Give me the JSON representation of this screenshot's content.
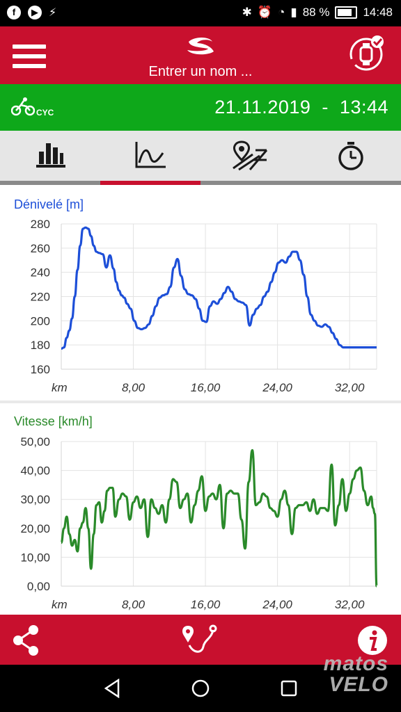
{
  "status": {
    "battery": "88 %",
    "time": "14:48"
  },
  "header": {
    "title": "Entrer un nom ..."
  },
  "activity": {
    "sport": "CYC",
    "date": "21.11.2019",
    "separator": "-",
    "time": "13:44"
  },
  "tabs": [
    {
      "icon": "bar-chart-icon",
      "active": false
    },
    {
      "icon": "line-chart-icon",
      "active": true
    },
    {
      "icon": "map-route-icon",
      "active": false
    },
    {
      "icon": "stopwatch-icon",
      "active": false
    }
  ],
  "watermark": [
    "matos",
    "VELO"
  ],
  "colors": {
    "brand": "#c8102e",
    "activity": "#0ea81a",
    "elevation": "#1d4fd8",
    "speed": "#2a8a2a"
  },
  "chart_data": [
    {
      "type": "line",
      "title": "Dénivelé [m]",
      "xlabel": "km",
      "ylabel": "",
      "xlim": [
        0,
        35
      ],
      "ylim": [
        160,
        280
      ],
      "xticks": [
        8,
        16,
        24,
        32
      ],
      "xtick_labels": [
        "8,00",
        "16,00",
        "24,00",
        "32,00"
      ],
      "yticks": [
        160,
        180,
        200,
        220,
        240,
        260,
        280
      ],
      "ytick_labels": [
        "160",
        "180",
        "200",
        "220",
        "240",
        "260",
        "280"
      ],
      "grid": true,
      "series": [
        {
          "x": [
            0,
            0.3,
            0.6,
            0.9,
            1.2,
            1.5,
            1.8,
            2.1,
            2.4,
            2.7,
            3.0,
            3.3,
            3.6,
            3.9,
            4.2,
            4.6,
            5.0,
            5.4,
            5.8,
            6.1,
            6.4,
            6.7,
            7.0,
            7.3,
            7.7,
            8.1,
            8.5,
            8.9,
            9.3,
            9.7,
            10.1,
            10.5,
            10.9,
            11.3,
            11.7,
            12.1,
            12.5,
            12.9,
            13.3,
            13.7,
            14.1,
            14.5,
            14.9,
            15.3,
            15.7,
            16.1,
            16.5,
            16.9,
            17.3,
            17.7,
            18.1,
            18.5,
            18.9,
            19.3,
            19.7,
            20.1,
            20.5,
            20.9,
            21.3,
            21.7,
            22.1,
            22.5,
            22.9,
            23.3,
            23.7,
            24.1,
            24.5,
            24.9,
            25.3,
            25.7,
            26.1,
            26.5,
            26.9,
            27.3,
            27.7,
            28.1,
            28.5,
            28.9,
            29.3,
            29.7,
            30.1,
            30.5,
            30.9,
            31.3,
            31.7,
            32.1,
            32.5,
            32.9,
            33.3,
            33.7,
            34.1,
            34.5,
            35.0
          ],
          "y": [
            177,
            178,
            186,
            192,
            202,
            220,
            242,
            262,
            276,
            277,
            276,
            270,
            262,
            257,
            256,
            255,
            244,
            254,
            243,
            232,
            225,
            221,
            219,
            214,
            210,
            200,
            194,
            193,
            194,
            197,
            204,
            212,
            219,
            221,
            222,
            228,
            244,
            251,
            237,
            226,
            222,
            221,
            218,
            210,
            200,
            199,
            212,
            216,
            214,
            218,
            223,
            228,
            224,
            218,
            216,
            215,
            213,
            196,
            205,
            210,
            213,
            220,
            224,
            232,
            240,
            248,
            250,
            248,
            253,
            257,
            257,
            250,
            238,
            220,
            205,
            200,
            196,
            195,
            197,
            195,
            190,
            185,
            180,
            178,
            178,
            178,
            178,
            178,
            178,
            178,
            178,
            178,
            178
          ]
        }
      ]
    },
    {
      "type": "line",
      "title": "Vitesse [km/h]",
      "xlabel": "km",
      "ylabel": "",
      "xlim": [
        0,
        35
      ],
      "ylim": [
        0,
        50
      ],
      "xticks": [
        8,
        16,
        24,
        32
      ],
      "xtick_labels": [
        "8,00",
        "16,00",
        "24,00",
        "32,00"
      ],
      "yticks": [
        0,
        10,
        20,
        30,
        40,
        50
      ],
      "ytick_labels": [
        "0,00",
        "10,00",
        "20,00",
        "30,00",
        "40,00",
        "50,00"
      ],
      "grid": true,
      "series": [
        {
          "x": [
            0,
            0.3,
            0.6,
            0.9,
            1.2,
            1.5,
            1.8,
            2.1,
            2.4,
            2.7,
            3.0,
            3.3,
            3.6,
            3.9,
            4.2,
            4.5,
            4.8,
            5.1,
            5.4,
            5.7,
            6.0,
            6.4,
            6.8,
            7.2,
            7.6,
            8.0,
            8.4,
            8.8,
            9.2,
            9.6,
            10.0,
            10.4,
            10.8,
            11.2,
            11.6,
            12.0,
            12.4,
            12.8,
            13.2,
            13.6,
            14.0,
            14.4,
            14.8,
            15.2,
            15.6,
            16.0,
            16.4,
            16.8,
            17.2,
            17.6,
            18.0,
            18.4,
            18.8,
            19.2,
            19.6,
            20.0,
            20.4,
            20.8,
            21.2,
            21.6,
            22.0,
            22.4,
            22.8,
            23.2,
            23.6,
            24.0,
            24.4,
            24.8,
            25.2,
            25.6,
            26.0,
            26.4,
            26.8,
            27.2,
            27.6,
            28.0,
            28.4,
            28.8,
            29.2,
            29.6,
            30.0,
            30.4,
            30.8,
            31.2,
            31.6,
            32.0,
            32.4,
            32.8,
            33.2,
            33.6,
            34.0,
            34.4,
            34.6,
            34.8,
            35.0
          ],
          "y": [
            15,
            20,
            24,
            18,
            14,
            16,
            12,
            20,
            22,
            27,
            20,
            6,
            18,
            28,
            29,
            22,
            26,
            33,
            34,
            34,
            24,
            30,
            32,
            31,
            23,
            29,
            31,
            27,
            30,
            17,
            30,
            27,
            25,
            28,
            22,
            30,
            37,
            36,
            27,
            30,
            32,
            22,
            28,
            33,
            38,
            26,
            31,
            32,
            30,
            35,
            20,
            32,
            33,
            32,
            32,
            23,
            13,
            36,
            47,
            28,
            29,
            32,
            31,
            27,
            26,
            24,
            30,
            33,
            28,
            18,
            27,
            28,
            28,
            29,
            26,
            30,
            25,
            27,
            27,
            26,
            42,
            21,
            28,
            37,
            26,
            32,
            37,
            40,
            41,
            33,
            28,
            31,
            27,
            25,
            0
          ]
        }
      ]
    }
  ]
}
